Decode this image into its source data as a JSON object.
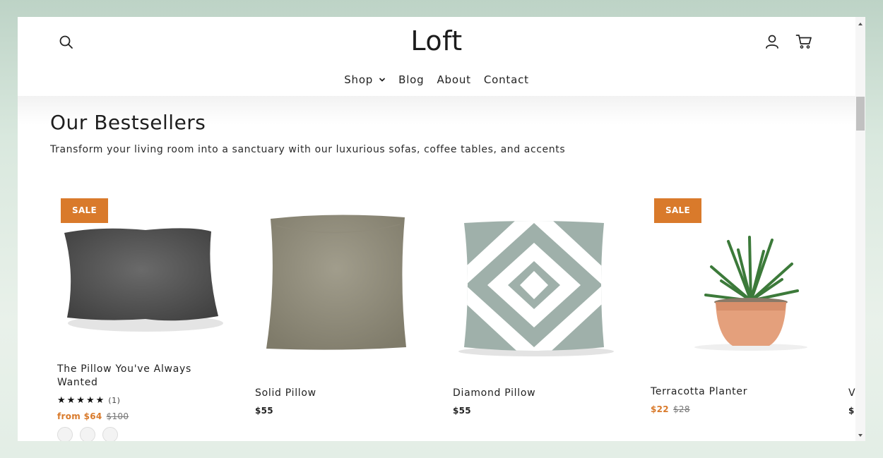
{
  "header": {
    "logo": "Loft",
    "nav": [
      {
        "label": "Shop"
      },
      {
        "label": "Blog"
      },
      {
        "label": "About"
      },
      {
        "label": "Contact"
      }
    ]
  },
  "section": {
    "title": "Our Bestsellers",
    "subtitle": "Transform your living room into a sanctuary with our luxurious sofas, coffee tables, and accents"
  },
  "products": [
    {
      "name": "The Pillow You've Always Wanted",
      "badge": "SALE",
      "rating": "★★★★★",
      "rating_count": "(1)",
      "price": "from $64",
      "old_price": "$100"
    },
    {
      "name": "Solid Pillow",
      "price": "$55"
    },
    {
      "name": "Diamond Pillow",
      "price": "$55"
    },
    {
      "name": "Terracotta Planter",
      "badge": "SALE",
      "price": "$22",
      "old_price": "$28"
    },
    {
      "name": "V",
      "price": "$"
    }
  ],
  "colors": {
    "sale_accent": "#d97a2b",
    "background_gradient": "#bdd3c6"
  },
  "icons": [
    "search-icon",
    "account-icon",
    "cart-icon",
    "chevron-down-icon",
    "star-icon"
  ]
}
